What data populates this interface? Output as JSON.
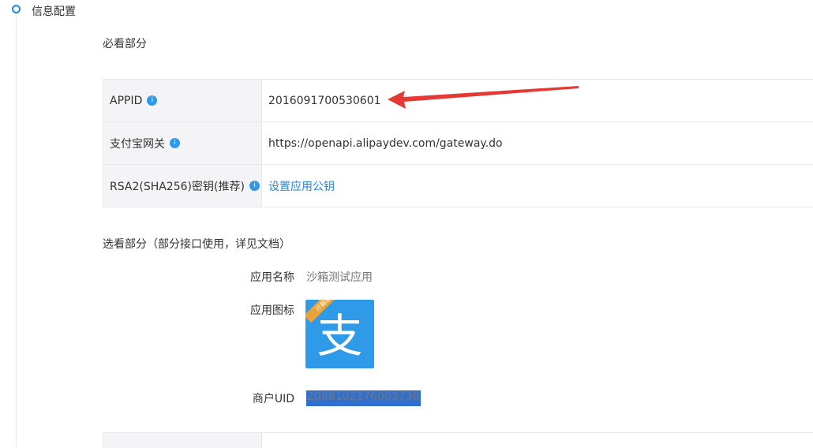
{
  "section": {
    "title": "信息配置"
  },
  "required": {
    "heading": "必看部分",
    "rows": [
      {
        "label": "APPID",
        "value": "2016091700530601"
      },
      {
        "label": "支付宝网关",
        "value": "https://openapi.alipaydev.com/gateway.do"
      },
      {
        "label": "RSA2(SHA256)密钥(推荐)",
        "value": "设置应用公钥"
      }
    ],
    "info_icon_text": "i"
  },
  "optional": {
    "heading": "选看部分（部分接口使用，详见文档）",
    "app_name_label": "应用名称",
    "app_name_value": "沙箱测试应用",
    "app_icon_label": "应用图标",
    "app_icon_ribbon": "沙箱版",
    "app_icon_glyph": "支",
    "merchant_uid_label": "商户UID",
    "merchant_uid_value": "2088102176003736"
  },
  "colors": {
    "accent": "#1e88e5",
    "arrow": "#e53935",
    "icon_bg": "#2f9be8",
    "ribbon": "#e8a43b"
  }
}
